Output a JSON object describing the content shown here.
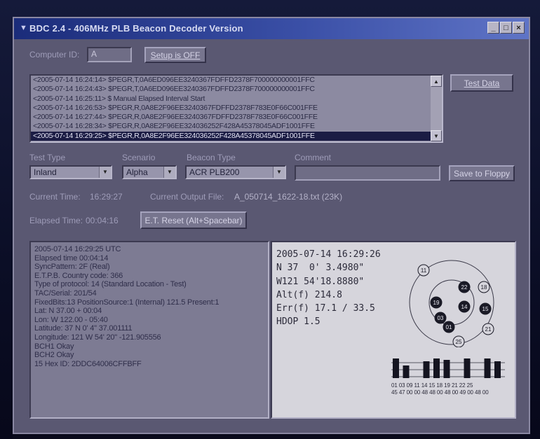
{
  "window": {
    "title": "BDC 2.4 - 406MHz PLB Beacon Decoder Version",
    "controls": [
      "_",
      "□",
      "×"
    ]
  },
  "computer_id": {
    "label": "Computer ID:",
    "value": "A"
  },
  "setup_button": "Setup is OFF",
  "log": {
    "lines": [
      "<2005-07-14 16:24:14> $PEGR,T,0A6ED096EE3240367FDFFD2378F700000000001FFC",
      "<2005-07-14 16:24:43> $PEGR,T,0A6ED096EE3240367FDFFD2378F700000000001FFC",
      "<2005-07-14 16:25:11> $ Manual Elapsed Interval Start",
      "<2005-07-14 16:26:53> $PEGR,R,0A8E2F96EE3240367FDFFD2378F783E0F66C001FFE",
      "<2005-07-14 16:27:44> $PEGR,R,0A8E2F96EE3240367FDFFD2378F783E0F66C001FFE",
      "<2005-07-14 16:28:34> $PEGR,R,0A8E2F96EE324036252F428A45378045ADF1001FFE",
      "<2005-07-14 16:29:25> $PEGR,R,0A8E2F96EE324036252F428A45378045ADF1001FFE"
    ],
    "selected_index": 6
  },
  "test_data_button": "Test Data",
  "headers": {
    "test_type": "Test Type",
    "scenario": "Scenario",
    "beacon_type": "Beacon Type",
    "comment": "Comment"
  },
  "selects": {
    "test_type": "Inland",
    "scenario": "Alpha",
    "beacon_type": "ACR PLB200"
  },
  "comment_value": "",
  "save_button": "Save to Floppy",
  "current_time": {
    "label": "Current Time:",
    "value": "16:29:27"
  },
  "output_file": {
    "label": "Current Output File:",
    "value": "A_050714_1622-18.txt (23K)"
  },
  "elapsed_time": {
    "label": "Elapsed Time:",
    "value": "00:04:16"
  },
  "reset_button": "E.T. Reset (Alt+Spacebar)",
  "status_lines": [
    "2005-07-14 16:29:25 UTC",
    "Elapsed time 00:04:14",
    "SyncPattern: 2F (Real)",
    "E.T.P.B. Country code: 366",
    "Type of protocol: 14 (Standard Location - Test)",
    "TAC/Serial: 201/54",
    "FixedBits:13  PositionSource:1 (Internal)  121.5 Present:1",
    "Lat: N 37.00 + 00:04",
    "Lon: W 122.00 - 05:40",
    "Latitude: 37 N  0' 4\" 37.001111",
    "Longitude: 121 W 54' 20\" -121.905556",
    "BCH1 Okay",
    "BCH2 Okay",
    "15 Hex ID: 2DDC64006CFFBFF"
  ],
  "gps": {
    "lines": [
      "2005-07-14 16:29:26",
      "N 37  0' 3.4980\"",
      "W121 54'18.8880\"",
      "Alt(f) 214.8",
      "Err(f) 17.1 / 33.5",
      "HDOP 1.5"
    ],
    "satellites": [
      "11",
      "22",
      "18",
      "19",
      "14",
      "15",
      "03",
      "01",
      "21",
      "25"
    ],
    "prn_row1": "01 03 09 11 14 15 18 19 21 22 25",
    "prn_row2": "45 47 00 00 48 48 00 48 00 49 00 48 00"
  }
}
